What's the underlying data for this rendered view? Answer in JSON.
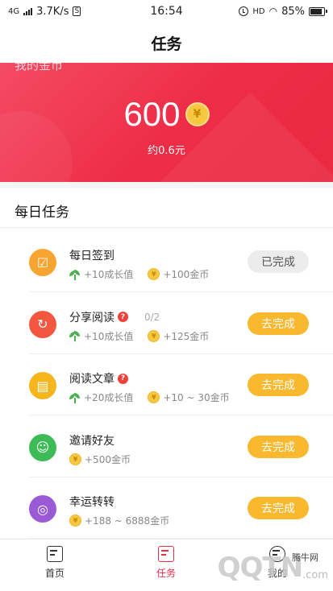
{
  "status_bar": {
    "network": "4G",
    "speed": "3.7K/s",
    "time": "16:54",
    "hd": "HD",
    "battery": "85%",
    "battery_level": 0.85
  },
  "header": {
    "title": "任务"
  },
  "banner": {
    "label": "我的金币",
    "coins": "600",
    "coin_symbol": "¥",
    "approx": "约0.6元"
  },
  "section": {
    "title": "每日任务"
  },
  "tasks": [
    {
      "name": "每日签到",
      "help": false,
      "progress": "",
      "growth": "+10成长值",
      "coins": "+100金币",
      "button": "已完成",
      "state": "done",
      "icon_color": "#f7a431",
      "icon": "calendar-check-icon",
      "icon_glyph": "☑"
    },
    {
      "name": "分享阅读",
      "help": true,
      "progress": "0/2",
      "growth": "+10成长值",
      "coins": "+125金币",
      "button": "去完成",
      "state": "todo",
      "icon_color": "#f3573f",
      "icon": "share-arrow-icon",
      "icon_glyph": "↻"
    },
    {
      "name": "阅读文章",
      "help": true,
      "progress": "",
      "growth": "+20成长值",
      "coins": "+10 ~ 30金币",
      "button": "去完成",
      "state": "todo",
      "icon_color": "#f5b51c",
      "icon": "article-icon",
      "icon_glyph": "▤"
    },
    {
      "name": "邀请好友",
      "help": false,
      "progress": "",
      "growth": "",
      "coins": "+500金币",
      "button": "去完成",
      "state": "todo",
      "icon_color": "#3dbb56",
      "icon": "friends-icon",
      "icon_glyph": "☺"
    },
    {
      "name": "幸运转转",
      "help": false,
      "progress": "",
      "growth": "",
      "coins": "+188 ~ 6888金币",
      "button": "去完成",
      "state": "todo",
      "icon_color": "#9a5ad6",
      "icon": "lucky-wheel-icon",
      "icon_glyph": "◎"
    }
  ],
  "tabs": [
    {
      "label": "首页",
      "active": false,
      "icon": "home-doc-icon"
    },
    {
      "label": "任务",
      "active": true,
      "icon": "task-clipboard-icon"
    },
    {
      "label": "我的",
      "active": false,
      "icon": "profile-icon"
    }
  ],
  "watermark": {
    "text": "QQTN",
    "sub": "腾牛网",
    "domain": ".com"
  },
  "colors": {
    "accent": "#ee2c46",
    "button_todo": "#f9b82d",
    "button_done": "#ececec"
  }
}
